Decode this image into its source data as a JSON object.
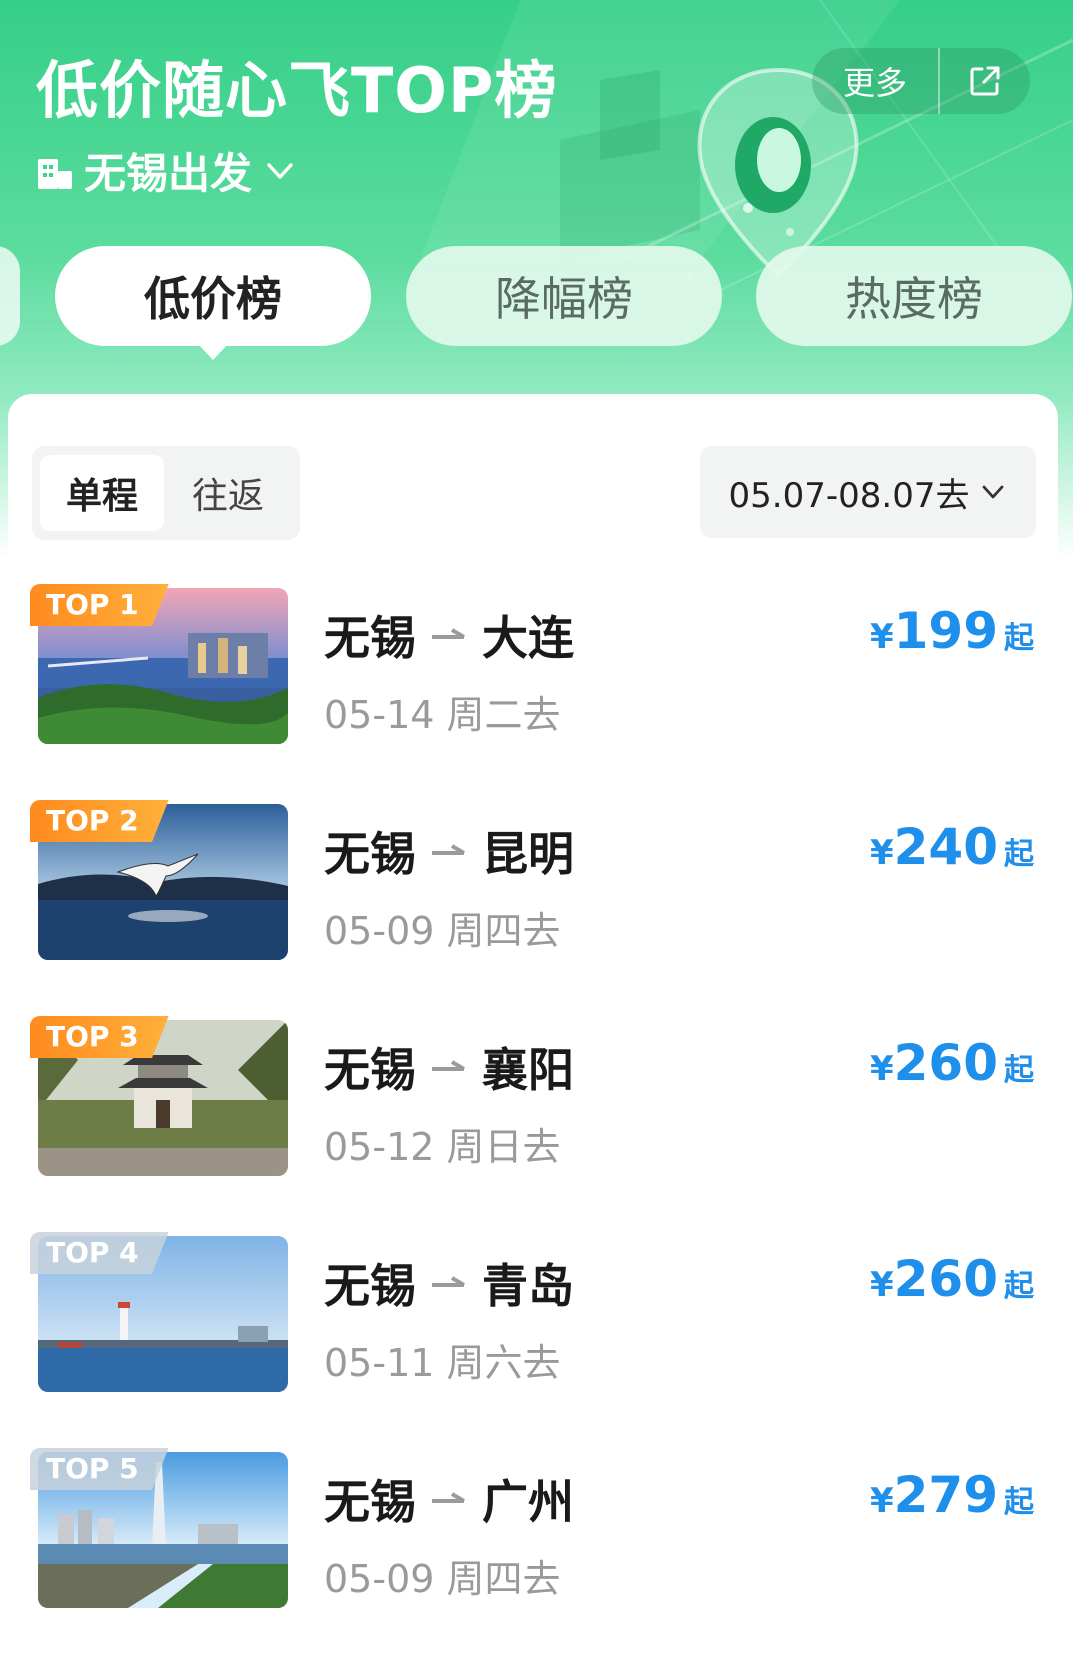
{
  "header": {
    "title": "低价随心飞TOP榜",
    "origin": "无锡出发",
    "more_label": "更多"
  },
  "tabs": [
    {
      "label": "低价榜",
      "active": true
    },
    {
      "label": "降幅榜",
      "active": false
    },
    {
      "label": "热度榜",
      "active": false
    }
  ],
  "filters": {
    "trip_types": [
      "单程",
      "往返"
    ],
    "selected_trip_type": "单程",
    "date_range": "05.07-08.07去"
  },
  "colors": {
    "brand_green": "#35cf88",
    "price_blue": "#1e8fea",
    "badge_orange": "#ff8a1e"
  },
  "flights": [
    {
      "rank": "TOP 1",
      "from": "无锡",
      "to": "大连",
      "date": "05-14 周二去",
      "currency": "¥",
      "price": "199",
      "price_suffix": "起"
    },
    {
      "rank": "TOP 2",
      "from": "无锡",
      "to": "昆明",
      "date": "05-09 周四去",
      "currency": "¥",
      "price": "240",
      "price_suffix": "起"
    },
    {
      "rank": "TOP 3",
      "from": "无锡",
      "to": "襄阳",
      "date": "05-12 周日去",
      "currency": "¥",
      "price": "260",
      "price_suffix": "起"
    },
    {
      "rank": "TOP 4",
      "from": "无锡",
      "to": "青岛",
      "date": "05-11 周六去",
      "currency": "¥",
      "price": "260",
      "price_suffix": "起"
    },
    {
      "rank": "TOP 5",
      "from": "无锡",
      "to": "广州",
      "date": "05-09 周四去",
      "currency": "¥",
      "price": "279",
      "price_suffix": "起"
    }
  ]
}
